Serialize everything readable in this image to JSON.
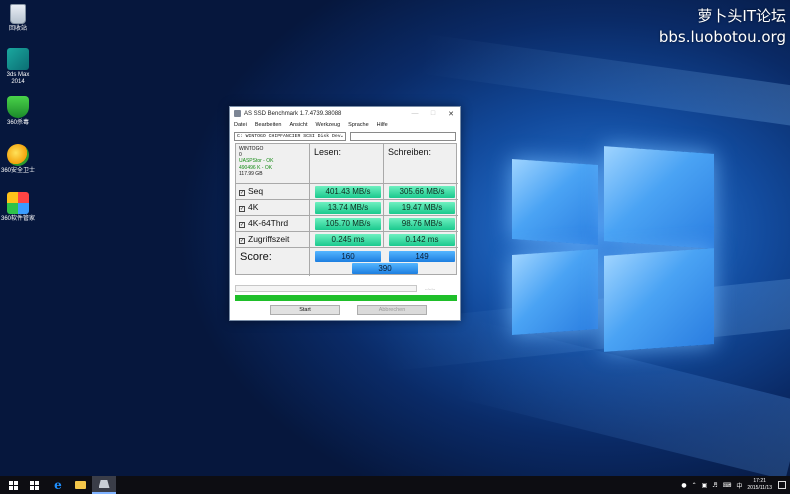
{
  "watermark": {
    "line1": "萝卜头IT论坛",
    "line2": "bbs.luobotou.org"
  },
  "desktop_icons": [
    {
      "label": "回收站",
      "icon": "recycle-bin-icon"
    },
    {
      "label": "3ds Max 2014",
      "icon": "3ds-max-icon"
    },
    {
      "label": "360杀毒",
      "icon": "360-antivirus-icon"
    },
    {
      "label": "360安全卫士",
      "icon": "360-safe-icon"
    },
    {
      "label": "360软件管家",
      "icon": "360-software-manager-icon"
    }
  ],
  "window": {
    "title": "AS SSD Benchmark 1.7.4739.38088",
    "menu": [
      "Datei",
      "Bearbeiten",
      "Ansicht",
      "Werkzeug",
      "Sprache",
      "Hilfe"
    ],
    "drive_select": "C: WINTOGO CHIPFANCIER SCSI Disk Dev",
    "info": {
      "name": "WINTOGO",
      "id": "0",
      "driver": "UASPStor - OK",
      "alignment": "490496 K - OK",
      "size": "117.99 GB"
    },
    "headers": {
      "read": "Lesen:",
      "write": "Schreiben:"
    },
    "rows": [
      {
        "label": "Seq",
        "read": "401.43 MB/s",
        "write": "305.66 MB/s",
        "checked": true
      },
      {
        "label": "4K",
        "read": "13.74 MB/s",
        "write": "19.47 MB/s",
        "checked": true
      },
      {
        "label": "4K-64Thrd",
        "read": "105.70 MB/s",
        "write": "98.76 MB/s",
        "checked": true
      },
      {
        "label": "Zugriffszeit",
        "read": "0.245 ms",
        "write": "0.142 ms",
        "checked": true
      }
    ],
    "score": {
      "label": "Score:",
      "read": "160",
      "write": "149",
      "total": "390"
    },
    "progress_text": "--:--:--",
    "progress_fraction": 1.0,
    "buttons": {
      "start": "Start",
      "abort": "Abbrechen"
    }
  },
  "taskbar": {
    "clock_time": "17:21",
    "clock_date": "2015/11/13",
    "ime": "中",
    "colors": {
      "accent": "#7fb2ff",
      "bar": "#0d0d12"
    }
  }
}
